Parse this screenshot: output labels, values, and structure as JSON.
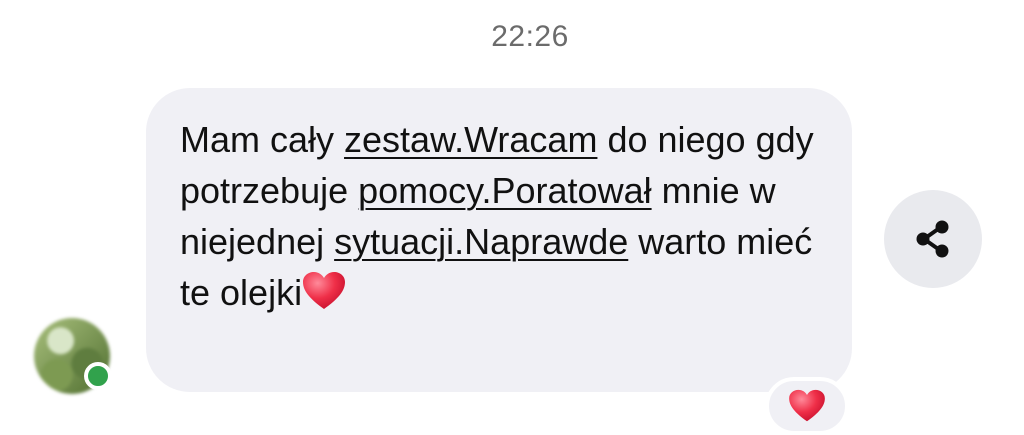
{
  "timestamp": "22:26",
  "message": {
    "segments": [
      {
        "text": "Mam cały ",
        "underline": false
      },
      {
        "text": "zestaw.Wracam",
        "underline": true
      },
      {
        "text": " do niego gdy potrzebuje ",
        "underline": false
      },
      {
        "text": "pomocy.Poratował",
        "underline": true
      },
      {
        "text": " mnie w niejednej ",
        "underline": false
      },
      {
        "text": "sytuacji.Naprawde",
        "underline": true
      },
      {
        "text": " warto mieć te olejki",
        "underline": false
      }
    ],
    "end_emoji": "heart-icon"
  },
  "sender": {
    "online": true,
    "status_color": "#31a24c"
  },
  "reaction": {
    "icon": "heart-icon",
    "color": "#e0202f"
  },
  "share": {
    "icon": "share-icon"
  },
  "colors": {
    "bubble": "#f0f0f5",
    "text": "#111111",
    "timestamp": "#6b6b6b",
    "heart": "#e0202f"
  }
}
